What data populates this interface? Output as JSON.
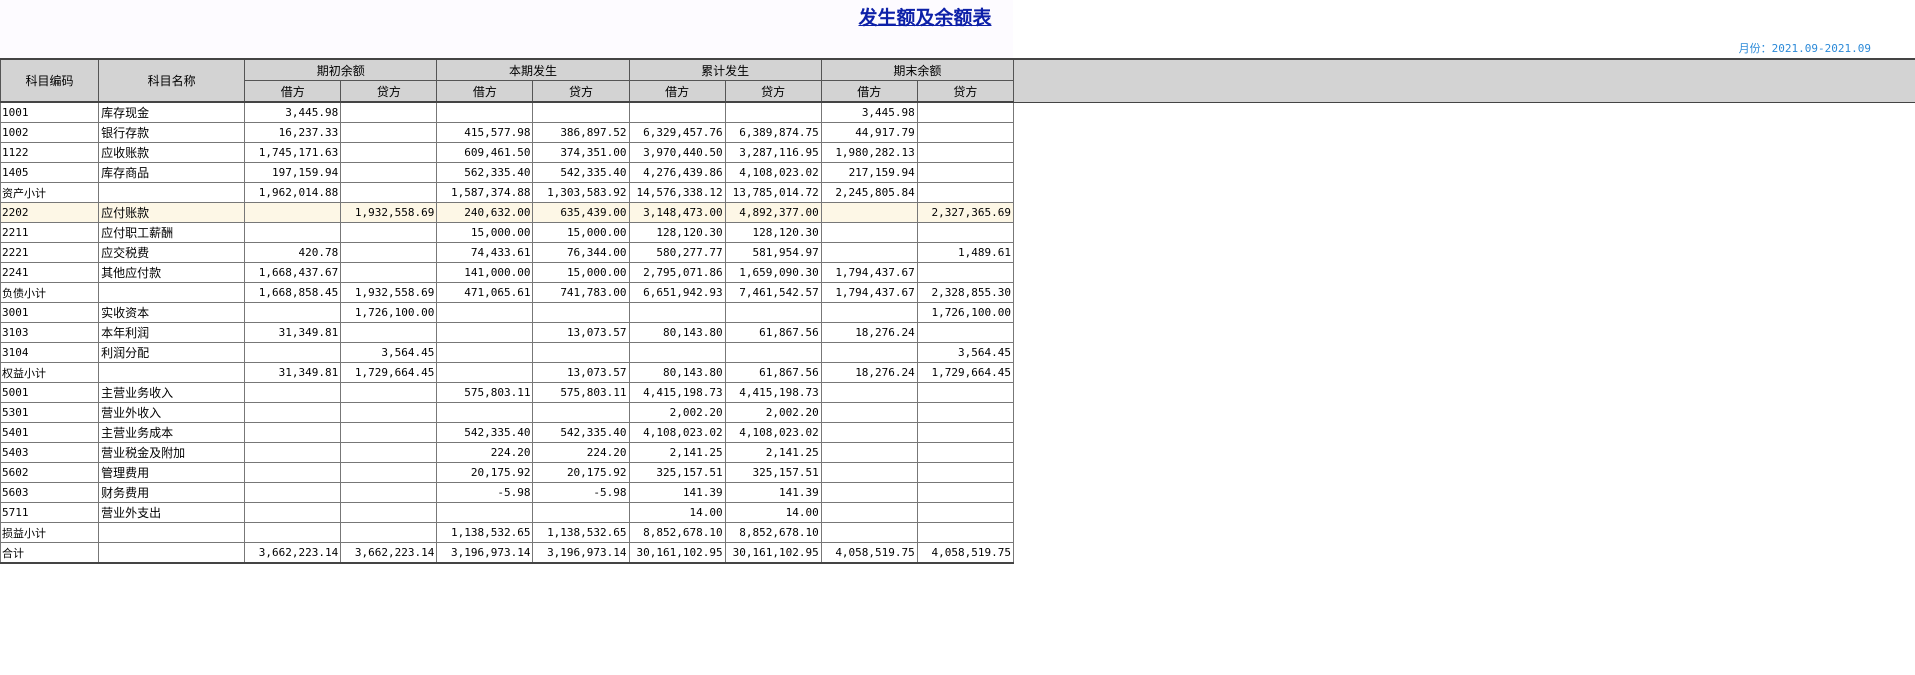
{
  "report": {
    "title": "发生额及余额表",
    "period": "月份：2021.09-2021.09"
  },
  "table": {
    "header_code": "科目编码",
    "header_name": "科目名称",
    "groups": [
      "期初余额",
      "本期发生",
      "累计发生",
      "期末余额"
    ],
    "debit_label": "借方",
    "credit_label": "贷方",
    "rows": [
      {
        "code": "1001",
        "name": "库存现金",
        "values": [
          "3,445.98",
          "",
          "",
          "",
          "",
          "",
          "3,445.98",
          ""
        ]
      },
      {
        "code": "1002",
        "name": "银行存款",
        "values": [
          "16,237.33",
          "",
          "415,577.98",
          "386,897.52",
          "6,329,457.76",
          "6,389,874.75",
          "44,917.79",
          ""
        ]
      },
      {
        "code": "1122",
        "name": "应收账款",
        "values": [
          "1,745,171.63",
          "",
          "609,461.50",
          "374,351.00",
          "3,970,440.50",
          "3,287,116.95",
          "1,980,282.13",
          ""
        ]
      },
      {
        "code": "1405",
        "name": "库存商品",
        "values": [
          "197,159.94",
          "",
          "562,335.40",
          "542,335.40",
          "4,276,439.86",
          "4,108,023.02",
          "217,159.94",
          ""
        ]
      },
      {
        "code": "资产小计",
        "name": "",
        "values": [
          "1,962,014.88",
          "",
          "1,587,374.88",
          "1,303,583.92",
          "14,576,338.12",
          "13,785,014.72",
          "2,245,805.84",
          ""
        ]
      },
      {
        "code": "2202",
        "name": "应付账款",
        "values": [
          "",
          "1,932,558.69",
          "240,632.00",
          "635,439.00",
          "3,148,473.00",
          "4,892,377.00",
          "",
          "2,327,365.69"
        ],
        "highlight": true
      },
      {
        "code": "2211",
        "name": "应付职工薪酬",
        "values": [
          "",
          "",
          "15,000.00",
          "15,000.00",
          "128,120.30",
          "128,120.30",
          "",
          ""
        ]
      },
      {
        "code": "2221",
        "name": "应交税费",
        "values": [
          "420.78",
          "",
          "74,433.61",
          "76,344.00",
          "580,277.77",
          "581,954.97",
          "",
          "1,489.61"
        ]
      },
      {
        "code": "2241",
        "name": "其他应付款",
        "values": [
          "1,668,437.67",
          "",
          "141,000.00",
          "15,000.00",
          "2,795,071.86",
          "1,659,090.30",
          "1,794,437.67",
          ""
        ]
      },
      {
        "code": "负债小计",
        "name": "",
        "values": [
          "1,668,858.45",
          "1,932,558.69",
          "471,065.61",
          "741,783.00",
          "6,651,942.93",
          "7,461,542.57",
          "1,794,437.67",
          "2,328,855.30"
        ]
      },
      {
        "code": "3001",
        "name": "实收资本",
        "values": [
          "",
          "1,726,100.00",
          "",
          "",
          "",
          "",
          "",
          "1,726,100.00"
        ]
      },
      {
        "code": "3103",
        "name": "本年利润",
        "values": [
          "31,349.81",
          "",
          "",
          "13,073.57",
          "80,143.80",
          "61,867.56",
          "18,276.24",
          ""
        ]
      },
      {
        "code": "3104",
        "name": "利润分配",
        "values": [
          "",
          "3,564.45",
          "",
          "",
          "",
          "",
          "",
          "3,564.45"
        ]
      },
      {
        "code": "权益小计",
        "name": "",
        "values": [
          "31,349.81",
          "1,729,664.45",
          "",
          "13,073.57",
          "80,143.80",
          "61,867.56",
          "18,276.24",
          "1,729,664.45"
        ]
      },
      {
        "code": "5001",
        "name": "主营业务收入",
        "values": [
          "",
          "",
          "575,803.11",
          "575,803.11",
          "4,415,198.73",
          "4,415,198.73",
          "",
          ""
        ]
      },
      {
        "code": "5301",
        "name": "营业外收入",
        "values": [
          "",
          "",
          "",
          "",
          "2,002.20",
          "2,002.20",
          "",
          ""
        ]
      },
      {
        "code": "5401",
        "name": "主营业务成本",
        "values": [
          "",
          "",
          "542,335.40",
          "542,335.40",
          "4,108,023.02",
          "4,108,023.02",
          "",
          ""
        ]
      },
      {
        "code": "5403",
        "name": "营业税金及附加",
        "values": [
          "",
          "",
          "224.20",
          "224.20",
          "2,141.25",
          "2,141.25",
          "",
          ""
        ]
      },
      {
        "code": "5602",
        "name": "管理费用",
        "values": [
          "",
          "",
          "20,175.92",
          "20,175.92",
          "325,157.51",
          "325,157.51",
          "",
          ""
        ]
      },
      {
        "code": "5603",
        "name": "财务费用",
        "values": [
          "",
          "",
          "-5.98",
          "-5.98",
          "141.39",
          "141.39",
          "",
          ""
        ]
      },
      {
        "code": "5711",
        "name": "营业外支出",
        "values": [
          "",
          "",
          "",
          "",
          "14.00",
          "14.00",
          "",
          ""
        ]
      },
      {
        "code": "损益小计",
        "name": "",
        "values": [
          "",
          "",
          "1,138,532.65",
          "1,138,532.65",
          "8,852,678.10",
          "8,852,678.10",
          "",
          ""
        ]
      },
      {
        "code": "合计",
        "name": "",
        "values": [
          "3,662,223.14",
          "3,662,223.14",
          "3,196,973.14",
          "3,196,973.14",
          "30,161,102.95",
          "30,161,102.95",
          "4,058,519.75",
          "4,058,519.75"
        ],
        "total": true
      }
    ]
  }
}
